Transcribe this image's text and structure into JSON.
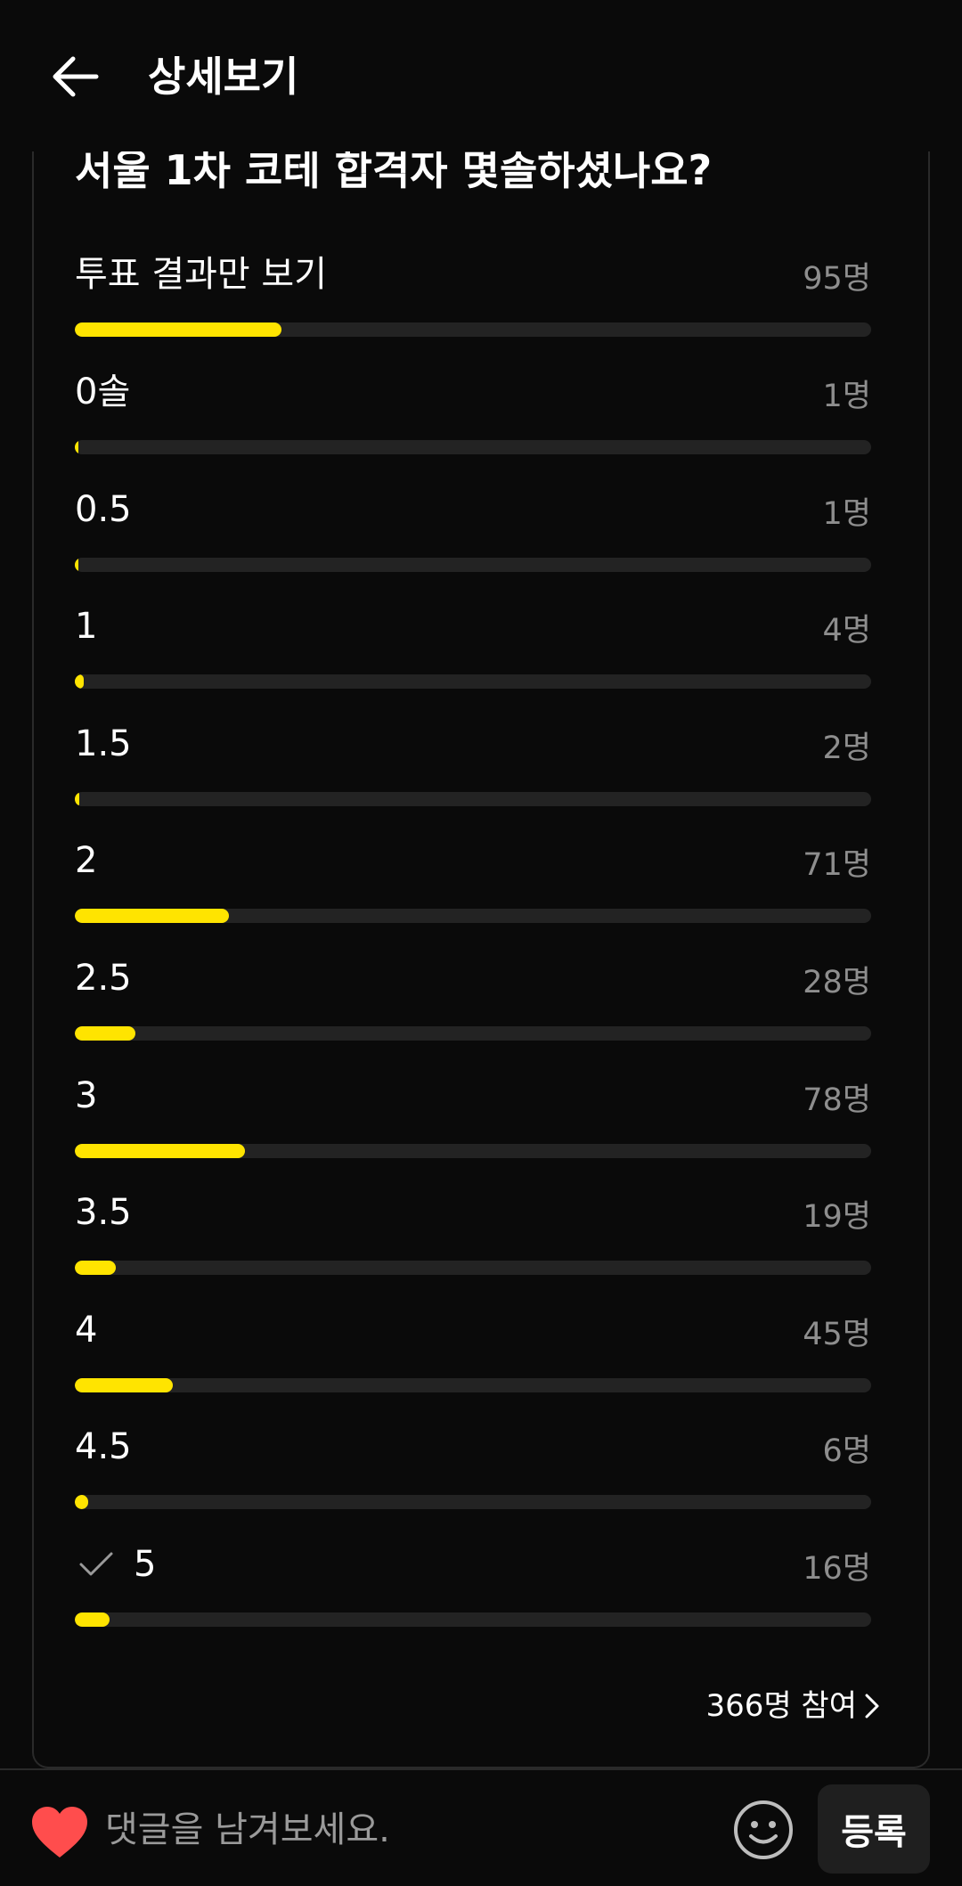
{
  "header": {
    "title": "상세보기"
  },
  "poll": {
    "question": "서울 1차 코테 합격자 몇솔하셨나요?",
    "summary": {
      "label": "투표 결과만 보기",
      "count": "95명",
      "fraction": 0.26
    },
    "options": [
      {
        "label": "0솔",
        "count": "1명",
        "votes": 1,
        "checked": false
      },
      {
        "label": "0.5",
        "count": "1명",
        "votes": 1,
        "checked": false
      },
      {
        "label": "1",
        "count": "4명",
        "votes": 4,
        "checked": false
      },
      {
        "label": "1.5",
        "count": "2명",
        "votes": 2,
        "checked": false
      },
      {
        "label": "2",
        "count": "71명",
        "votes": 71,
        "checked": false
      },
      {
        "label": "2.5",
        "count": "28명",
        "votes": 28,
        "checked": false
      },
      {
        "label": "3",
        "count": "78명",
        "votes": 78,
        "checked": false
      },
      {
        "label": "3.5",
        "count": "19명",
        "votes": 19,
        "checked": false
      },
      {
        "label": "4",
        "count": "45명",
        "votes": 45,
        "checked": false
      },
      {
        "label": "4.5",
        "count": "6명",
        "votes": 6,
        "checked": false
      },
      {
        "label": "5",
        "count": "16명",
        "votes": 16,
        "checked": true
      }
    ],
    "total_votes": 366,
    "participants": "366명 참여"
  },
  "comment_bar": {
    "placeholder": "댓글을 남겨보세요.",
    "submit_label": "등록"
  },
  "colors": {
    "accent": "#ffe400",
    "track": "#232323",
    "heart": "#ff4d4d"
  }
}
